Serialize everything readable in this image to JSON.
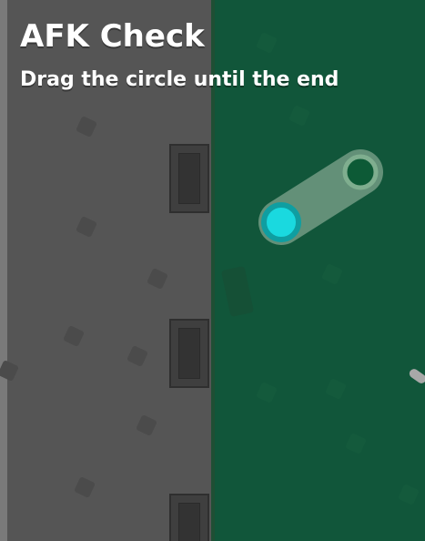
{
  "hud": {
    "title": "AFK Check",
    "subtitle": "Drag the circle until the end"
  },
  "afk_slider": {
    "progress": 0,
    "track_color": "#a7c1ac",
    "handle_color": "#1ad9df",
    "handle_ring_color": "#0f9ea1",
    "end_marker_color": "#0d5a36",
    "end_marker_ring_color": "#7fae8f"
  },
  "colors": {
    "left_zone": "#555555",
    "left_zone_edge": "#7a7a7a",
    "right_zone": "#11563a",
    "text": "#ffffff"
  },
  "icons": {
    "bone": "bone-icon"
  }
}
